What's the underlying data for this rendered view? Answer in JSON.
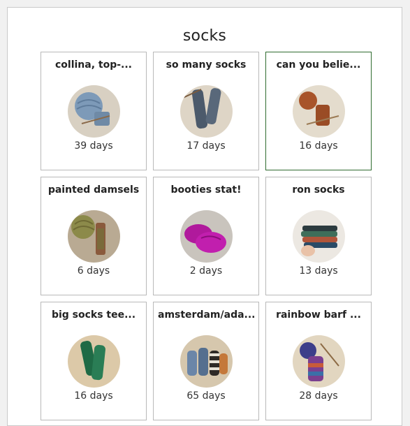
{
  "page": {
    "title": "socks"
  },
  "cards": [
    {
      "title": "collina, top-...",
      "days": "39 days",
      "icon": "yarn-ball-sock-photo"
    },
    {
      "title": "so many socks",
      "days": "17 days",
      "icon": "grey-socks-photo"
    },
    {
      "title": "can you belie...",
      "days": "16 days",
      "icon": "brown-sock-photo"
    },
    {
      "title": "painted damsels",
      "days": "6 days",
      "icon": "painted-yarn-photo"
    },
    {
      "title": "booties stat!",
      "days": "2 days",
      "icon": "magenta-booties-photo"
    },
    {
      "title": "ron socks",
      "days": "13 days",
      "icon": "sock-stack-hand-photo"
    },
    {
      "title": "big socks tee...",
      "days": "16 days",
      "icon": "green-socks-photo"
    },
    {
      "title": "amsterdam/ada...",
      "days": "65 days",
      "icon": "striped-socks-photo"
    },
    {
      "title": "rainbow barf ...",
      "days": "28 days",
      "icon": "rainbow-sock-photo"
    }
  ]
}
